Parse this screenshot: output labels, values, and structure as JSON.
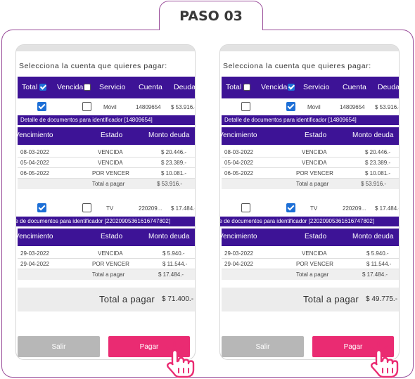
{
  "step_label": "PASO 03",
  "panels": [
    {
      "prompt": "Selecciona la cuenta que quieres pagar:",
      "header": {
        "total": "Total",
        "total_checked": true,
        "vencida": "Vencida",
        "vencida_checked": false,
        "servicio": "Servicio",
        "cuenta": "Cuenta",
        "deuda": "Deuda"
      },
      "accounts": [
        {
          "total_checked": true,
          "vencida_checked": false,
          "servicio": "Móvil",
          "cuenta": "14809654",
          "deuda": "$ 53.916.-",
          "detail_title": "Detalle de documentos para identificador [14809654]",
          "cols": {
            "vencimiento": "Vencimiento",
            "estado": "Estado",
            "monto": "Monto deuda"
          },
          "rows": [
            {
              "fecha": "08-03-2022",
              "estado": "VENCIDA",
              "monto": "$ 20.446.-"
            },
            {
              "fecha": "05-04-2022",
              "estado": "VENCIDA",
              "monto": "$ 23.389.-"
            },
            {
              "fecha": "06-05-2022",
              "estado": "POR VENCER",
              "monto": "$ 10.081.-"
            }
          ],
          "total_label": "Total a pagar",
          "total_value": "$ 53.916.-"
        },
        {
          "total_checked": true,
          "vencida_checked": false,
          "servicio": "TV",
          "cuenta": "220209...",
          "deuda": "$ 17.484.-",
          "detail_title": "de de documentos para identificador [22020905361616747802]",
          "cols": {
            "vencimiento": "Vencimiento",
            "estado": "Estado",
            "monto": "Monto deuda"
          },
          "rows": [
            {
              "fecha": "29-03-2022",
              "estado": "VENCIDA",
              "monto": "$ 5.940.-"
            },
            {
              "fecha": "29-04-2022",
              "estado": "POR VENCER",
              "monto": "$ 11.544.-"
            }
          ],
          "total_label": "Total a pagar",
          "total_value": "$ 17.484.-"
        }
      ],
      "grand_total_label": "Total a pagar",
      "grand_total_value": "$ 71.400.-",
      "btn_salir": "Salir",
      "btn_pagar": "Pagar"
    },
    {
      "prompt": "Selecciona la cuenta que quieres pagar:",
      "header": {
        "total": "Total",
        "total_checked": false,
        "vencida": "Vencida",
        "vencida_checked": true,
        "servicio": "Servicio",
        "cuenta": "Cuenta",
        "deuda": "Deuda"
      },
      "accounts": [
        {
          "total_checked": false,
          "vencida_checked": true,
          "servicio": "Móvil",
          "cuenta": "14809654",
          "deuda": "$ 53.916.-",
          "detail_title": "Detalle de documentos para identificador [14809654]",
          "cols": {
            "vencimiento": "Vencimiento",
            "estado": "Estado",
            "monto": "Monto deuda"
          },
          "rows": [
            {
              "fecha": "08-03-2022",
              "estado": "VENCIDA",
              "monto": "$ 20.446.-"
            },
            {
              "fecha": "05-04-2022",
              "estado": "VENCIDA",
              "monto": "$ 23.389.-"
            },
            {
              "fecha": "06-05-2022",
              "estado": "POR VENCER",
              "monto": "$ 10.081.-"
            }
          ],
          "total_label": "Total a pagar",
          "total_value": "$ 53.916.-"
        },
        {
          "total_checked": false,
          "vencida_checked": true,
          "servicio": "TV",
          "cuenta": "220209...",
          "deuda": "$ 17.484.-",
          "detail_title": "de de documentos para identificador [22020905361616747802]",
          "cols": {
            "vencimiento": "Vencimiento",
            "estado": "Estado",
            "monto": "Monto deuda"
          },
          "rows": [
            {
              "fecha": "29-03-2022",
              "estado": "VENCIDA",
              "monto": "$ 5.940.-"
            },
            {
              "fecha": "29-04-2022",
              "estado": "POR VENCER",
              "monto": "$ 11.544.-"
            }
          ],
          "total_label": "Total a pagar",
          "total_value": "$ 17.484.-"
        }
      ],
      "grand_total_label": "Total a pagar",
      "grand_total_value": "$ 49.775.-",
      "btn_salir": "Salir",
      "btn_pagar": "Pagar"
    }
  ],
  "colors": {
    "frame": "#9b4f9b",
    "header": "#3d1396",
    "checkbox": "#1d6fd6",
    "pay_button": "#ea2b72",
    "exit_button": "#b7b7b7"
  },
  "icons": [
    "checkbox-icon",
    "pointing-hand-icon"
  ]
}
